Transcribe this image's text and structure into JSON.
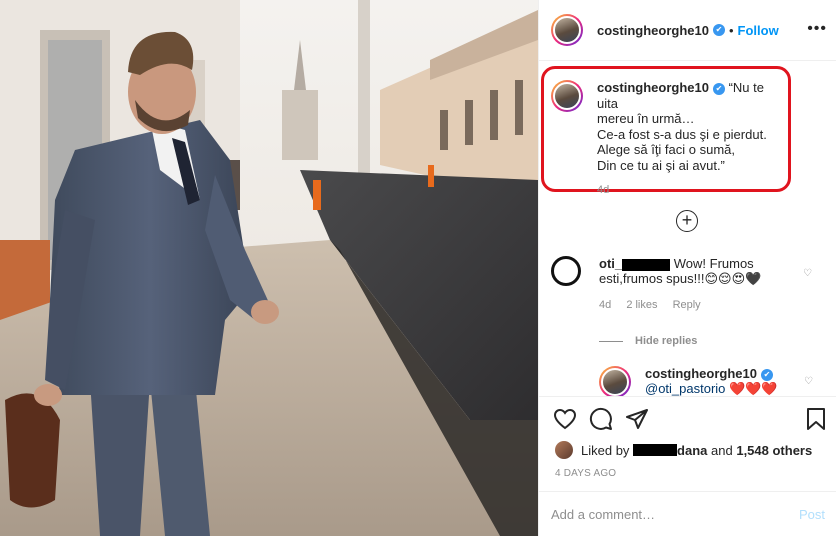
{
  "post": {
    "username": "costingheorghe10",
    "verified_glyph": "✔",
    "separator": "•",
    "follow_label": "Follow",
    "more_icon": "•••"
  },
  "caption": {
    "username": "costingheorghe10",
    "text": " “Nu te uita\nmereu în urmă…\nCe-a fost s-a dus şi e pierdut.\nAlege să îţi faci o sumă,\nDin ce tu ai şi ai avut.”",
    "time": "4d",
    "highlight_color": "#e0141e"
  },
  "load_more_icon": "+",
  "comments": [
    {
      "username_visible": "oti_",
      "text": "Wow! Frumos esti,frumos spus!!!😊😌😍🖤",
      "time": "4d",
      "likes": "2 likes",
      "reply_label": "Reply"
    }
  ],
  "hide_replies_label": "Hide replies",
  "reply": {
    "username": "costingheorghe10",
    "text": "@oti_pastorio ❤️❤️❤️"
  },
  "actions": {
    "liked_prefix": "Liked by",
    "liked_user_suffix": "dana",
    "liked_and": "and",
    "liked_count": "1,548 others",
    "timestamp": "4 DAYS AGO"
  },
  "comment_bar": {
    "placeholder": "Add a comment…",
    "post_label": "Post"
  },
  "colors": {
    "accent": "#0095f6",
    "verified": "#3897f0",
    "muted": "#8e8e8e"
  }
}
